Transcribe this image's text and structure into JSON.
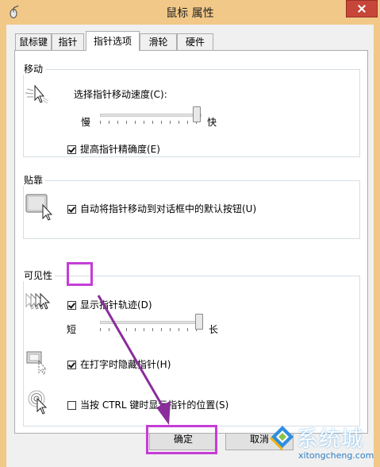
{
  "window": {
    "title": "鼠标 属性"
  },
  "tabs": [
    {
      "label": "鼠标键"
    },
    {
      "label": "指针"
    },
    {
      "label": "指针选项"
    },
    {
      "label": "滑轮"
    },
    {
      "label": "硬件"
    }
  ],
  "active_tab": "指针选项",
  "motion": {
    "title": "移动",
    "speed_label": "选择指针移动速度(C):",
    "slow_label": "慢",
    "fast_label": "快",
    "speed_level": 0.95,
    "precision_label": "提高指针精确度(E)",
    "precision_checked": true
  },
  "snap": {
    "title": "贴靠",
    "snap_label": "自动将指针移动到对话框中的默认按钮(U)",
    "snap_checked": true
  },
  "visibility": {
    "title": "可见性",
    "trails_label": "显示指针轨迹(D)",
    "trails_checked": true,
    "short_label": "短",
    "long_label": "长",
    "trail_level": 0.98,
    "hide_label": "在打字时隐藏指针(H)",
    "hide_checked": true,
    "ctrl_label": "当按 CTRL 键时显示指针的位置(S)",
    "ctrl_checked": false
  },
  "buttons": {
    "ok": "确定",
    "cancel": "取消"
  },
  "watermark": {
    "name": "系统城",
    "url": "xitongcheng.com"
  },
  "annotation_color": "#c53dd6"
}
